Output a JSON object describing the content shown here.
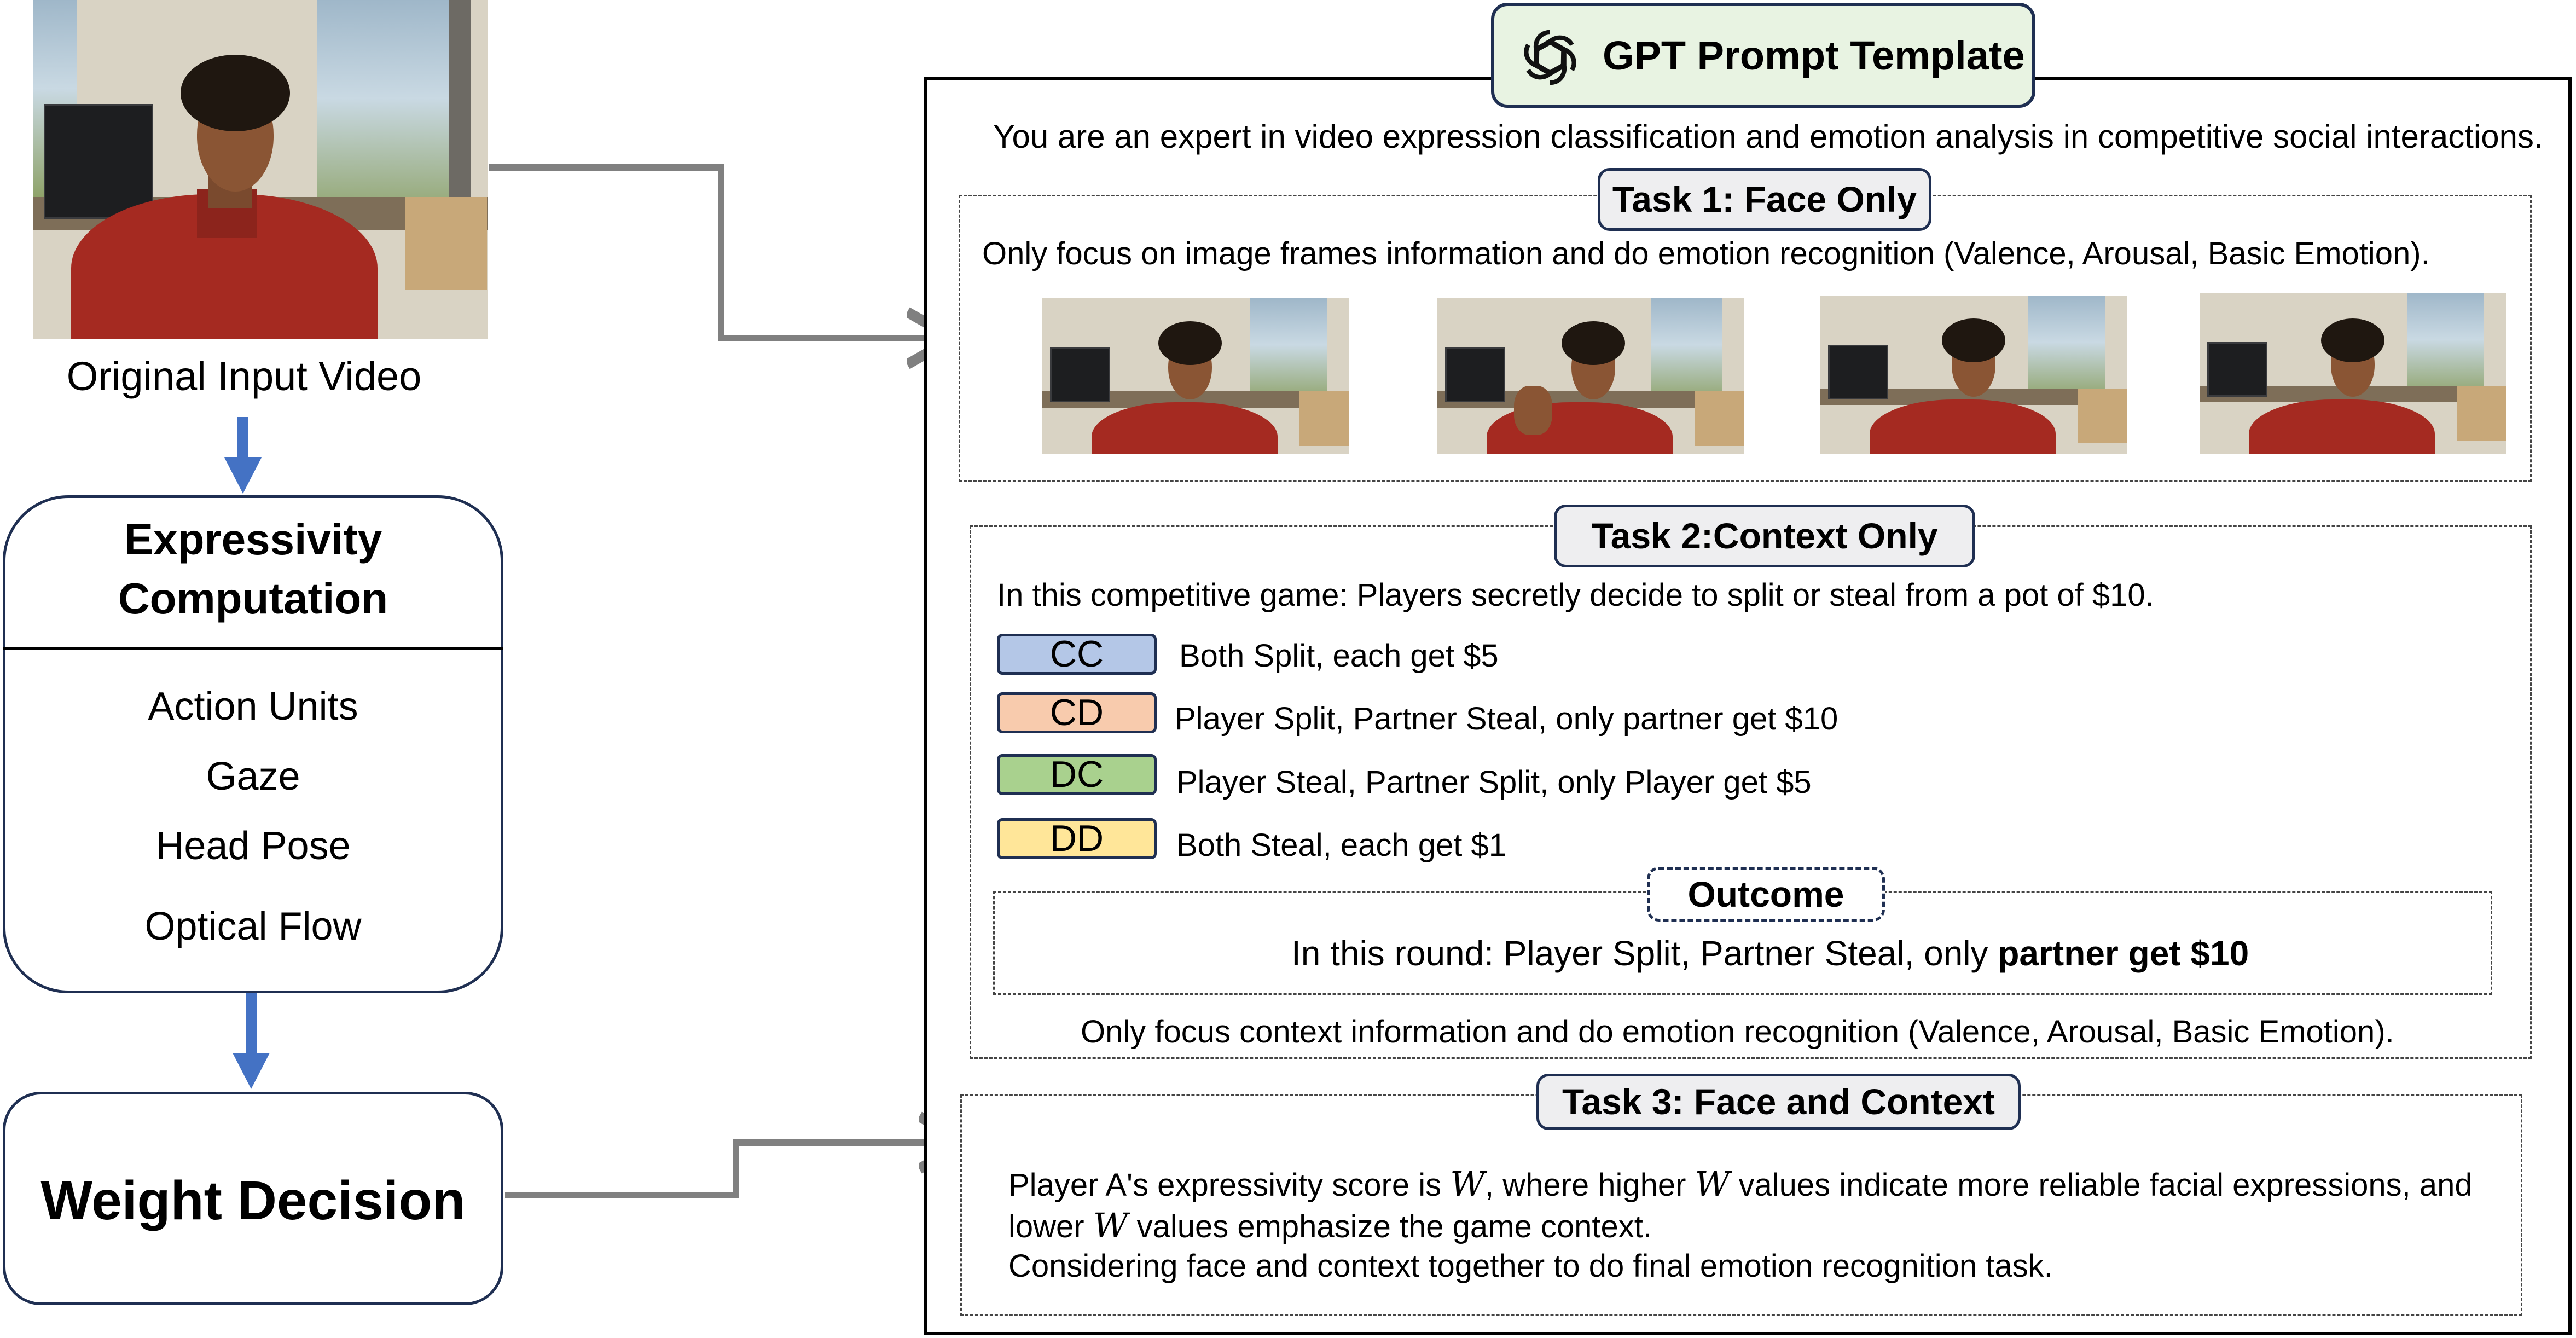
{
  "left": {
    "input_label": "Original Input Video",
    "expressivity_title_line1": "Expressivity",
    "expressivity_title_line2": "Computation",
    "features": [
      "Action Units",
      "Gaze",
      "Head Pose",
      "Optical Flow"
    ],
    "weight_decision": "Weight Decision"
  },
  "template": {
    "title": "GPT Prompt Template",
    "intro": "You are an expert in video expression classification and emotion analysis in competitive social interactions.",
    "task1": {
      "label": "Task 1: Face Only",
      "text": "Only focus on image frames information and do emotion recognition (Valence, Arousal, Basic Emotion)."
    },
    "task2": {
      "label": "Task 2:Context Only",
      "intro": "In this competitive game:  Players secretly decide to split or steal from a pot of $10.",
      "outcomes": [
        {
          "code": "CC",
          "text": "Both Split, each get $5",
          "color": "#b4c7e7"
        },
        {
          "code": "CD",
          "text": "Player Split, Partner Steal,  only partner get $10",
          "color": "#f8cbad"
        },
        {
          "code": "DC",
          "text": "Player Steal, Partner Split, only Player get $5",
          "color": "#a9d18e"
        },
        {
          "code": "DD",
          "text": "Both Steal, each get $1",
          "color": "#ffe699"
        }
      ],
      "outcome_label": "Outcome",
      "outcome_text_plain": "In this round: Player Split, Partner Steal, only ",
      "outcome_text_bold": "partner get $10",
      "footer": "Only focus context information and do emotion recognition (Valence, Arousal, Basic Emotion)."
    },
    "task3": {
      "label": "Task 3: Face and Context",
      "line1_a": "Player A's expressivity score is ",
      "line1_var": "W",
      "line1_b": ", where higher ",
      "line1_c": " values indicate more reliable facial expressions, and",
      "line2_a": "lower ",
      "line2_b": " values emphasize the game context.",
      "line3": "Considering face and context together to do final emotion recognition task."
    }
  },
  "colors": {
    "arrow_blue": "#4472c4",
    "arrow_gray": "#808080",
    "border_navy": "#1f2f52",
    "header_fill": "#e8f3e2"
  },
  "icons": [
    "openai-logo-icon"
  ]
}
